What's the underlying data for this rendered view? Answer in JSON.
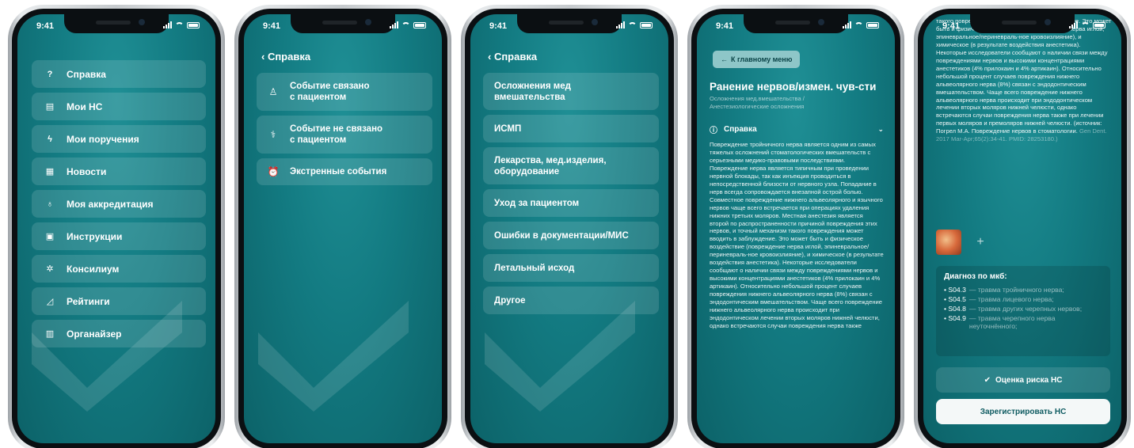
{
  "status": {
    "time": "9:41"
  },
  "screen1": {
    "items": [
      {
        "icon": "?",
        "label": "Справка"
      },
      {
        "icon": "▤",
        "label": "Мои НС"
      },
      {
        "icon": "ϟ",
        "label": "Мои поручения"
      },
      {
        "icon": "▦",
        "label": "Новости"
      },
      {
        "icon": "♁",
        "label": "Моя аккредитация"
      },
      {
        "icon": "▣",
        "label": "Инструкции"
      },
      {
        "icon": "✲",
        "label": "Консилиум"
      },
      {
        "icon": "◿",
        "label": "Рейтинги"
      },
      {
        "icon": "▥",
        "label": "Органайзер"
      }
    ]
  },
  "screen2": {
    "header": "‹ Справка",
    "items": [
      {
        "icon": "♙",
        "line1": "Событие связано",
        "line2": "с пациентом"
      },
      {
        "icon": "⚕",
        "line1": "Событие не связано",
        "line2": "с пациентом"
      },
      {
        "icon": "⏰",
        "line1": "Экстренные события",
        "line2": ""
      }
    ]
  },
  "screen3": {
    "header": "‹ Справка",
    "items": [
      {
        "line1": "Осложнения мед",
        "line2": "вмешательства"
      },
      {
        "line1": "ИСМП",
        "line2": ""
      },
      {
        "line1": "Лекарства, мед.изделия,",
        "line2": "оборудование"
      },
      {
        "line1": "Уход за пациентом",
        "line2": ""
      },
      {
        "line1": "Ошибки в документации/МИС",
        "line2": ""
      },
      {
        "line1": "Летальный исход",
        "line2": ""
      },
      {
        "line1": "Другое",
        "line2": ""
      }
    ]
  },
  "screen4": {
    "back": "К главному меню",
    "title": "Ранение нервов/измен. чув-сти",
    "crumb1": "Осложнения мед.вмешательства /",
    "crumb2": "Анестезиологические осложнения",
    "section": "Справка",
    "body": "Повреждение тройничного нерва является одним из самых тяжелых осложнений стоматологических вмешательств с серьезными медико-правовыми последствиями. Повреждение нерва является типичным при проведении нервной блокады, так как инъекция проводиться в непосредственной близости от нервного узла. Попадание в нерв всегда сопровождается внезапной острой болью. Совместное повреждение нижнего альвеолярного и язычного нервов чаще всего встречается при операциях удаления нижних третьих моляров. Местная анестезия является второй по распространенности причиной повреждения этих нервов, и точный механизм такого повреждения может вводить в заблуждение. Это может быть и физическое воздействие (повреждение нерва иглой, эпиневральное/периневраль-ное кровоизлияние), и химическое (в результате воздействия анестетика). Некоторые исследователи сообщают о наличии связи между повреждениями нервов и высокими концентрациями анестетиков (4% прилокаин и 4% артикаин). Относительно небольшой процент случаев повреждения нижнего альвеолярного нерва (8%) связан с эндодонтическим вмешательством. Чаще всего повреждение нижнего альвеолярного нерва происходит при эндодонтическом лечении вторых моляров нижней челюсти, однако встречаются случаи повреждения нерва также"
  },
  "screen5": {
    "body": "такого повреждения может вводить в заблуждение. Это может быть и физическое воздействие (повреждение нерва иглой, эпиневральное/периневраль-ное кровоизлияние), и химическое (в результате воздействия анестетика). Некоторые исследователи сообщают о наличии связи между повреждениями нервов и высокими концентрациями анестетиков (4% прилокаин и 4% артикаин). Относительно небольшой процент случаев повреждения нижнего альвеолярного нерва (8%) связан с эндодонтическим вмешательством. Чаще всего повреждение нижнего альвеолярного нерва происходит при эндодонтическом лечении вторых моляров нижней челюсти, однако встречаются случаи повреждения нерва также при лечении первых моляров и премоляров нижней челюсти. (источник: Погрел М.А. Повреждение нервов в стоматологии.",
    "source": "Gen Dent. 2017 Mar-Apr;65(2):34-41. PMID: 28253180.)",
    "diag_title": "Диагноз по мкб:",
    "diag": [
      {
        "code": "S04.3",
        "desc": "— травма тройничного нерва;"
      },
      {
        "code": "S04.5",
        "desc": "— травма лицевого нерва;"
      },
      {
        "code": "S04.8",
        "desc": "— травма других черепных нервов;"
      },
      {
        "code": "S04.9",
        "desc": "— травма черепного нерва неуточнённого;"
      }
    ],
    "risk_btn": "Оценка риска НС",
    "register_btn": "Зарегистрировать НС"
  }
}
